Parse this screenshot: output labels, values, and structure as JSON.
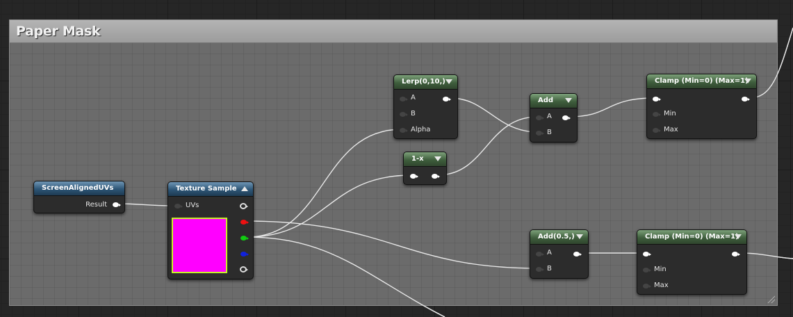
{
  "comment": {
    "title": "Paper Mask"
  },
  "nodes": {
    "screen_aligned_uvs": {
      "title": "ScreenAlignedUVs",
      "output": "Result"
    },
    "texture_sample": {
      "title": "Texture Sample",
      "input": "UVs",
      "preview_color": "#ff00ff"
    },
    "lerp": {
      "title": "Lerp(0,10,)",
      "inputs": [
        "A",
        "B",
        "Alpha"
      ]
    },
    "one_minus": {
      "title": "1-x"
    },
    "add": {
      "title": "Add",
      "inputs": [
        "A",
        "B"
      ]
    },
    "clamp_top": {
      "title": "Clamp (Min=0) (Max=1)",
      "inputs": [
        "Min",
        "Max"
      ]
    },
    "add_half": {
      "title": "Add(0.5,)",
      "inputs": [
        "A",
        "B"
      ]
    },
    "clamp_bottom": {
      "title": "Clamp (Min=0) (Max=1)",
      "inputs": [
        "Min",
        "Max"
      ]
    }
  },
  "colors": {
    "header_green": "#3f5e3d",
    "header_blue": "#2d5576",
    "pin_red": "#ee1111",
    "pin_green": "#11cc11",
    "pin_blue": "#1122dd"
  }
}
